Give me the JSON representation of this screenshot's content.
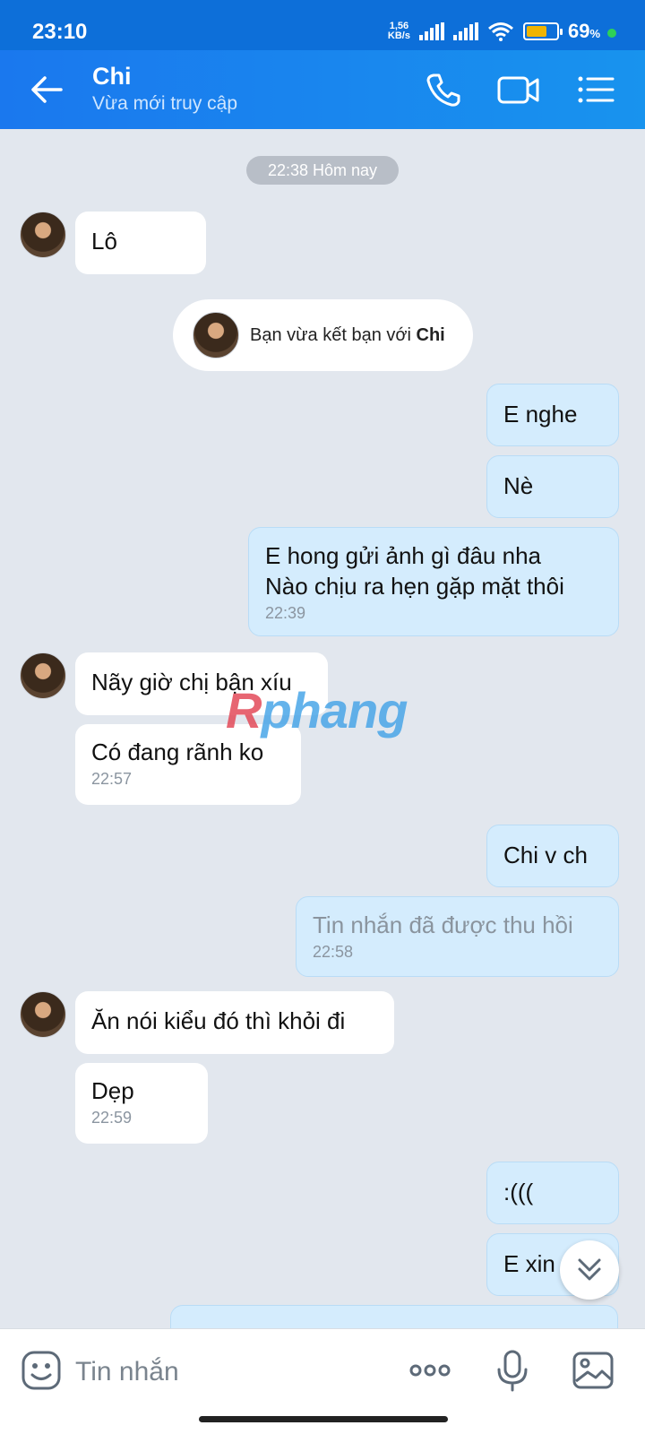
{
  "status_bar": {
    "time": "23:10",
    "net_speed_value": "1,56",
    "net_speed_unit": "KB/s",
    "battery_percent": "69",
    "battery_unit": "%",
    "battery_level": 0.69
  },
  "header": {
    "contact_name": "Chi",
    "contact_status": "Vừa mới truy cập",
    "icons": [
      "back-arrow-icon",
      "phone-icon",
      "video-call-icon",
      "menu-list-icon"
    ]
  },
  "chat": {
    "date_chip": "22:38 Hôm nay",
    "friend_notice_prefix": "Bạn vừa kết bạn với",
    "friend_notice_name": "Chi",
    "messages": [
      {
        "dir": "in",
        "text": "Lô",
        "time": ""
      },
      {
        "dir": "out",
        "text": "E nghe",
        "time": ""
      },
      {
        "dir": "out",
        "text": "Nè",
        "time": ""
      },
      {
        "dir": "out",
        "text_line1": "E hong gửi ảnh gì đâu nha",
        "text_line2": "Nào chịu ra hẹn gặp mặt thôi",
        "time": "22:39"
      },
      {
        "dir": "in",
        "text": "Nãy giờ chị bận xíu",
        "time": ""
      },
      {
        "dir": "in",
        "text": "Có đang rãnh ko",
        "time": "22:57"
      },
      {
        "dir": "out",
        "text": "Chi v ch",
        "time": ""
      },
      {
        "dir": "out",
        "text": "Tin nhắn đã được thu hồi",
        "time": "22:58"
      },
      {
        "dir": "in",
        "text": "Ăn nói kiểu đó thì khỏi đi",
        "time": ""
      },
      {
        "dir": "in",
        "text": "Dẹp",
        "time": "22:59"
      },
      {
        "dir": "out",
        "text": ":(((",
        "time": ""
      },
      {
        "dir": "out",
        "text": "E xin",
        "time": ""
      }
    ],
    "watermark": {
      "part1": "R",
      "part2": "phang"
    }
  },
  "composer": {
    "placeholder": "Tin nhắn",
    "icons": [
      "sticker-icon",
      "more-dots-icon",
      "microphone-icon",
      "image-gallery-icon"
    ]
  },
  "colors": {
    "header_blue": "#1a78ee",
    "status_bar_blue": "#0d6fd9",
    "chat_bg": "#e2e7ee",
    "outgoing_bubble": "#d4ecfd",
    "incoming_bubble": "#ffffff"
  }
}
